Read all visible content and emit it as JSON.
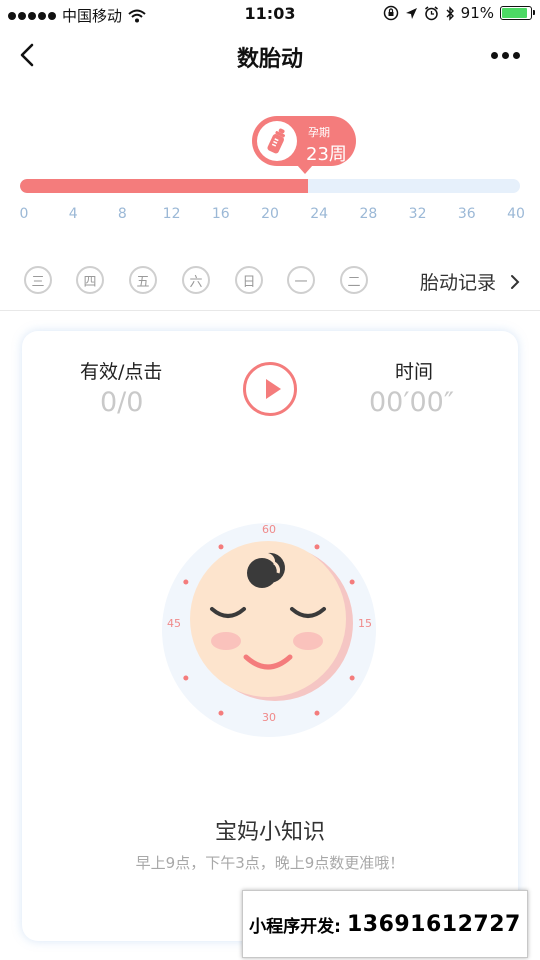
{
  "status_bar": {
    "carrier": "中国移动",
    "time": "11:03",
    "battery": "91%",
    "battery_level": 0.91
  },
  "nav": {
    "title": "数胎动"
  },
  "pregnancy": {
    "label": "孕期",
    "value": "23周",
    "current_week": 23,
    "max_week": 40,
    "ticks": [
      "0",
      "4",
      "8",
      "12",
      "16",
      "20",
      "24",
      "28",
      "32",
      "36",
      "40"
    ],
    "accent_color": "#f47c7c",
    "track_color": "#e6f0fb"
  },
  "days": [
    "三",
    "四",
    "五",
    "六",
    "日",
    "一",
    "二"
  ],
  "record_link": "胎动记录",
  "counter": {
    "left_label": "有效/点击",
    "left_value": "0/0",
    "right_label": "时间",
    "right_value": "00′00″"
  },
  "dial": {
    "labels": [
      "60",
      "15",
      "30",
      "45"
    ]
  },
  "tips": {
    "title": "宝妈小知识",
    "text": "早上9点，下午3点，晚上9点数更准哦！"
  },
  "promo": {
    "label": "小程序开发:",
    "number": "13691612727"
  }
}
